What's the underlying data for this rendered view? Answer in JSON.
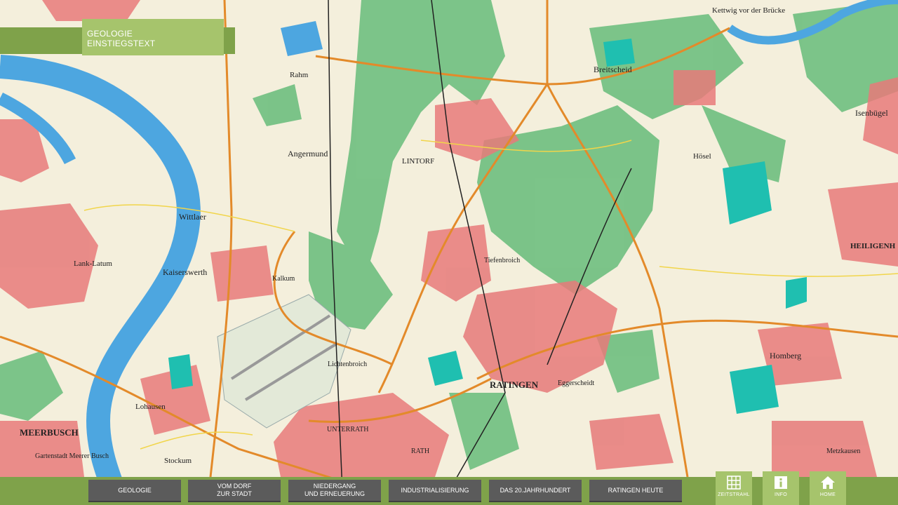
{
  "header": {
    "title_line1": "GEOLOGIE",
    "title_line2": "EINSTIEGSTEXT"
  },
  "map": {
    "labels": {
      "ratingen": "RATINGEN",
      "lintorf": "LINTORF",
      "meerbusch": "MEERBUSCH",
      "kaiserswerth": "Kaiserswerth",
      "angermund": "Angermund",
      "homberg": "Homberg",
      "heiligenhaus": "HEILIGENH",
      "isenbuegel": "Isenbügel",
      "breitscheid": "Breitscheid",
      "wittlaer": "Wittlaer",
      "lank_latum": "Lank-Latum",
      "lohausen": "Lohausen",
      "kettwig": "Kettwig vor der Brücke",
      "hoesel": "Hösel",
      "tiefenbroich": "Tiefenbroich",
      "eggerscheidt": "Eggerscheidt",
      "rahm": "Rahm",
      "kalkum": "Kalkum",
      "stockum": "Stockum",
      "metzkausen": "Metzkausen",
      "gartenstadt": "Gartenstadt Meerer Busch",
      "lichtenbroich": "Lichtenbroich",
      "unterrath": "UNTERRATH",
      "rath": "RATH"
    }
  },
  "nav": {
    "items": [
      {
        "line1": "GEOLOGIE",
        "line2": ""
      },
      {
        "line1": "VOM DORF",
        "line2": "ZUR STADT"
      },
      {
        "line1": "NIEDERGANG",
        "line2": "UND ERNEUERUNG"
      },
      {
        "line1": "INDUSTRIALISIERUNG",
        "line2": ""
      },
      {
        "line1": "DAS 20.JAHRHUNDERT",
        "line2": ""
      },
      {
        "line1": "RATINGEN HEUTE",
        "line2": ""
      }
    ]
  },
  "tools": {
    "zeitstrahl": "ZEITSTRAHL",
    "info": "INFO",
    "home": "HOME"
  },
  "colors": {
    "accent_green": "#7fa24a",
    "light_green": "#a6c46c",
    "nav_gray": "#5b5b5b",
    "river": "#4da6e0",
    "forest": "#6fbf7f",
    "urban": "#e77a7a",
    "water_teal": "#1fbfb0"
  }
}
